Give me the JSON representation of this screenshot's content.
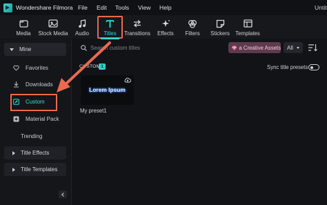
{
  "app": {
    "name": "Wondershare Filmora",
    "window_title": "Untitled"
  },
  "menu": [
    "File",
    "Edit",
    "Tools",
    "View",
    "Help"
  ],
  "tabs": [
    {
      "label": "Media",
      "icon": "media-folder-icon"
    },
    {
      "label": "Stock Media",
      "icon": "stock-media-icon"
    },
    {
      "label": "Audio",
      "icon": "music-note-icon"
    },
    {
      "label": "Titles",
      "icon": "titles-t-icon",
      "active": true
    },
    {
      "label": "Transitions",
      "icon": "transitions-icon"
    },
    {
      "label": "Effects",
      "icon": "effects-sparkle-icon"
    },
    {
      "label": "Filters",
      "icon": "filters-icon"
    },
    {
      "label": "Stickers",
      "icon": "stickers-icon"
    },
    {
      "label": "Templates",
      "icon": "templates-icon"
    }
  ],
  "sidebar": {
    "mine_label": "Mine",
    "items": [
      {
        "label": "Favorites",
        "icon": "heart-icon"
      },
      {
        "label": "Downloads",
        "icon": "download-icon"
      },
      {
        "label": "Custom",
        "icon": "edit-pencil-icon",
        "active": true
      },
      {
        "label": "Material Pack",
        "icon": "material-pack-icon"
      }
    ],
    "trending_label": "Trending",
    "groups": [
      {
        "label": "Title Effects"
      },
      {
        "label": "Title Templates"
      }
    ]
  },
  "toolbar": {
    "search_placeholder": "Search custom titles",
    "creative_assets_label": "a Creative Assets",
    "filter_value": "All"
  },
  "content": {
    "section_label": "CUSTOM",
    "count": "1",
    "sync_label": "Sync title presets",
    "sync_on": false,
    "preset_thumbnail_text": "Lorem Ipsum",
    "preset_name": "My preset1"
  },
  "colors": {
    "accent": "#2fe0d5",
    "highlight": "#ea6a4f",
    "background": "#121317"
  }
}
